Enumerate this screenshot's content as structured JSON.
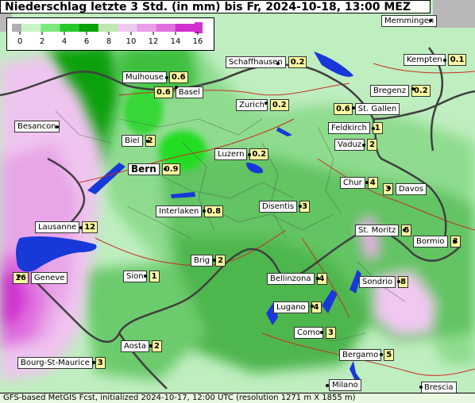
{
  "title": "Niederschlag letzte 3 Std. (in mm) bis Fr, 2024-10-18, 13:00 MEZ",
  "footer": "GFS-based MetGIS Fcst, initialized 2024-10-17, 12:00 UTC  (resolution 1271 m X 1855 m)",
  "legend": {
    "unit": "mm",
    "ticks": [
      "0",
      "2",
      "4",
      "6",
      "8",
      "10",
      "12",
      "14",
      "16"
    ],
    "colors": [
      "#c8f5c8",
      "#7ee87e",
      "#28c828",
      "#0ca00c",
      "#bfe8b0",
      "#f0c8f0",
      "#e8a0e8",
      "#e070e0",
      "#d030d0"
    ]
  },
  "colors": {
    "lake": "#1838d8",
    "border": "#404040",
    "river": "#c83020"
  },
  "stations": [
    {
      "name": "Memmingen",
      "value": ""
    },
    {
      "name": "Schaffhausen",
      "value": "0.2"
    },
    {
      "name": "Kempten",
      "value": "0.1"
    },
    {
      "name": "Mulhouse",
      "value": "0.6"
    },
    {
      "name": "Basel",
      "value": "0.6"
    },
    {
      "name": "Bregenz",
      "value": "0.2"
    },
    {
      "name": "Zurich",
      "value": "0.2"
    },
    {
      "name": "St. Gallen",
      "value": "0.6"
    },
    {
      "name": "Besancon",
      "value": ""
    },
    {
      "name": "Feldkirch",
      "value": "1"
    },
    {
      "name": "Biel",
      "value": "2"
    },
    {
      "name": "Vaduz",
      "value": "2"
    },
    {
      "name": "Luzern",
      "value": "0.2"
    },
    {
      "name": "Bern",
      "value": "0.9"
    },
    {
      "name": "Chur",
      "value": "4"
    },
    {
      "name": "Davos",
      "value": "3"
    },
    {
      "name": "Disentis",
      "value": "3"
    },
    {
      "name": "Interlaken",
      "value": "0.8"
    },
    {
      "name": "Lausanne",
      "value": "12"
    },
    {
      "name": "St. Moritz",
      "value": "5"
    },
    {
      "name": "Bormio",
      "value": "3"
    },
    {
      "name": "Brig",
      "value": "2"
    },
    {
      "name": "Sion",
      "value": "1"
    },
    {
      "name": "Geneve",
      "value": "16"
    },
    {
      "name": "Bellinzona",
      "value": "4"
    },
    {
      "name": "Sondrio",
      "value": "8"
    },
    {
      "name": "Lugano",
      "value": "4"
    },
    {
      "name": "Como",
      "value": "3"
    },
    {
      "name": "Aosta",
      "value": "2"
    },
    {
      "name": "Bergamo",
      "value": "5"
    },
    {
      "name": "Bourg-St-Maurice",
      "value": "3"
    },
    {
      "name": "Milano",
      "value": ""
    },
    {
      "name": "Brescia",
      "value": ""
    }
  ]
}
